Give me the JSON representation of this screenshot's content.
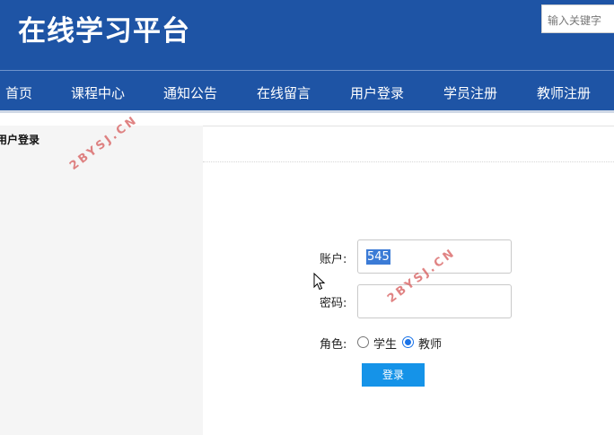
{
  "header": {
    "title": "在线学习平台",
    "search_placeholder": "输入关键字"
  },
  "nav": {
    "items": [
      "首页",
      "课程中心",
      "通知公告",
      "在线留言",
      "用户登录",
      "学员注册",
      "教师注册"
    ]
  },
  "sidebar": {
    "title": "用户登录"
  },
  "login_form": {
    "account_label": "账户:",
    "account_value": "545",
    "password_label": "密码:",
    "role_label": "角色:",
    "role_options": [
      "学生",
      "教师"
    ],
    "selected_role": "教师",
    "submit_label": "登录"
  },
  "watermark": "2BYSJ.CN",
  "colors": {
    "header_blue": "#1e54a5",
    "button_blue": "#1593e8",
    "selection_blue": "#3b7bd6",
    "watermark_red": "#d65a5a"
  }
}
